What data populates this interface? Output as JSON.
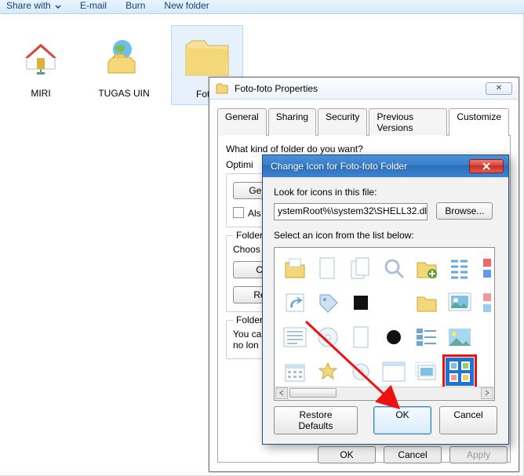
{
  "toolbar": {
    "share": "Share with",
    "email": "E-mail",
    "burn": "Burn",
    "newfolder": "New folder"
  },
  "explorer": {
    "items": [
      {
        "name": "MIRI"
      },
      {
        "name": "TUGAS UIN"
      },
      {
        "name": "Foto-"
      }
    ]
  },
  "props": {
    "title": "Foto-foto Properties",
    "close_glyph": "✕",
    "tabs": [
      "General",
      "Sharing",
      "Security",
      "Previous Versions",
      "Customize"
    ],
    "q1": "What kind of folder do you want?",
    "opt": "Optimi",
    "gener": "Gener",
    "also": "Als",
    "g2": "Folder",
    "choos": "Choos",
    "ch": "Ch",
    "res": "Res",
    "g3": "Folder",
    "nolon": "You ca\nno lon",
    "ok": "OK",
    "cancel": "Cancel",
    "apply": "Apply"
  },
  "sub": {
    "title": "Change Icon for Foto-foto Folder",
    "look": "Look for icons in this file:",
    "path": "ystemRoot%\\system32\\SHELL32.dll",
    "browse": "Browse...",
    "select": "Select an icon from the list below:",
    "restore": "Restore Defaults",
    "ok": "OK",
    "cancel": "Cancel"
  }
}
